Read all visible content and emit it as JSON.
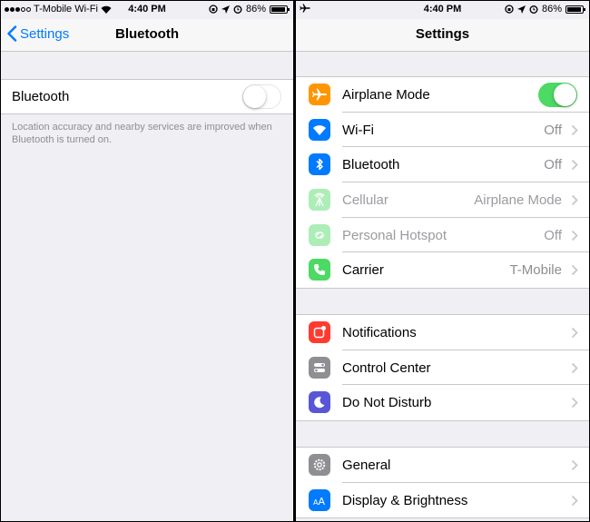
{
  "left": {
    "status": {
      "carrier": "T-Mobile Wi-Fi",
      "time": "4:40 PM",
      "battery": "86%",
      "battery_level": 0.86
    },
    "nav": {
      "back_label": "Settings",
      "title": "Bluetooth"
    },
    "bluetooth_row": {
      "label": "Bluetooth",
      "enabled": false
    },
    "note": "Location accuracy and nearby services are improved when Bluetooth is turned on."
  },
  "right": {
    "status": {
      "time": "4:40 PM",
      "battery": "86%",
      "battery_level": 0.86
    },
    "nav": {
      "title": "Settings"
    },
    "groups": [
      [
        {
          "name": "airplane-mode",
          "label": "Airplane Mode",
          "icon": "airplane-icon",
          "color": "#ff9500",
          "toggle": true,
          "on": true
        },
        {
          "name": "wifi",
          "label": "Wi-Fi",
          "value": "Off",
          "icon": "wifi-icon",
          "color": "#007aff"
        },
        {
          "name": "bluetooth",
          "label": "Bluetooth",
          "value": "Off",
          "icon": "bluetooth-icon",
          "color": "#007aff"
        },
        {
          "name": "cellular",
          "label": "Cellular",
          "value": "Airplane Mode",
          "icon": "cellular-icon",
          "color": "#4cd964",
          "dim": true
        },
        {
          "name": "personal-hotspot",
          "label": "Personal Hotspot",
          "value": "Off",
          "icon": "hotspot-icon",
          "color": "#4cd964",
          "dim": true
        },
        {
          "name": "carrier",
          "label": "Carrier",
          "value": "T-Mobile",
          "icon": "phone-icon",
          "color": "#4cd964"
        }
      ],
      [
        {
          "name": "notifications",
          "label": "Notifications",
          "icon": "notifications-icon",
          "color": "#ff3b30"
        },
        {
          "name": "control-center",
          "label": "Control Center",
          "icon": "control-center-icon",
          "color": "#8e8e93"
        },
        {
          "name": "do-not-disturb",
          "label": "Do Not Disturb",
          "icon": "moon-icon",
          "color": "#5856d6"
        }
      ],
      [
        {
          "name": "general",
          "label": "General",
          "icon": "gear-icon",
          "color": "#8e8e93"
        },
        {
          "name": "display-brightness",
          "label": "Display & Brightness",
          "icon": "text-size-icon",
          "color": "#007aff"
        }
      ]
    ]
  }
}
